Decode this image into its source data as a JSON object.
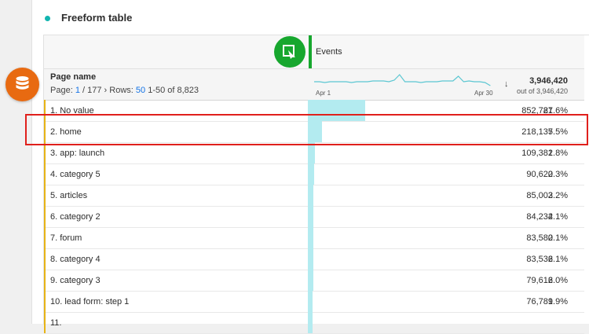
{
  "panel": {
    "title": "Freeform table"
  },
  "metric": {
    "label": "Events"
  },
  "dimension": {
    "name": "Page name",
    "page_label": "Page:",
    "page_current": "1",
    "page_total": "/ 177",
    "rows_label": "Rows:",
    "rows_value": "50",
    "range": "1-50 of 8,823"
  },
  "sparkline": {
    "start_label": "Apr 1",
    "end_label": "Apr 30"
  },
  "sort_icon": "arrow-down",
  "totals": {
    "value": "3,946,420",
    "out_of": "out of 3,946,420"
  },
  "rows": [
    {
      "label": "1.  No value",
      "value": "852,787",
      "pct": "21.6%",
      "share": 0.216
    },
    {
      "label": "2.  home",
      "value": "218,137",
      "pct": "5.5%",
      "share": 0.055
    },
    {
      "label": "3.  app: launch",
      "value": "109,381",
      "pct": "2.8%",
      "share": 0.028
    },
    {
      "label": "4.  category 5",
      "value": "90,620",
      "pct": "2.3%",
      "share": 0.023
    },
    {
      "label": "5.  articles",
      "value": "85,003",
      "pct": "2.2%",
      "share": 0.022
    },
    {
      "label": "6.  category 2",
      "value": "84,234",
      "pct": "2.1%",
      "share": 0.021
    },
    {
      "label": "7.  forum",
      "value": "83,580",
      "pct": "2.1%",
      "share": 0.021
    },
    {
      "label": "8.  category 4",
      "value": "83,536",
      "pct": "2.1%",
      "share": 0.021
    },
    {
      "label": "9.  category 3",
      "value": "79,616",
      "pct": "2.0%",
      "share": 0.02
    },
    {
      "label": "10.  lead form: step 1",
      "value": "76,789",
      "pct": "1.9%",
      "share": 0.019
    },
    {
      "label": "11.",
      "value": "",
      "pct": "",
      "share": 0.018
    }
  ],
  "colors": {
    "accent_teal": "#12b5b0",
    "segment_green": "#17a72e",
    "bar_cyan": "#b3ebf0",
    "row_marker": "#e7b416",
    "segment_orange": "#e86a11",
    "highlight_red": "#e0201c"
  }
}
